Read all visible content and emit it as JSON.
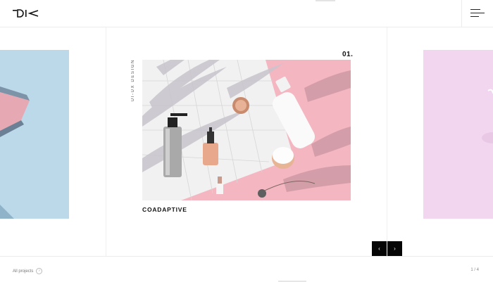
{
  "header": {
    "logo_alt": "logo",
    "menu_icon": "hamburger-icon"
  },
  "slide": {
    "number": "01.",
    "category": "UI-UX DESIGN",
    "title": "COADAPTIVE",
    "prev_label": "‹",
    "next_label": "›"
  },
  "footer": {
    "all_projects": "All projects",
    "all_projects_icon": "›",
    "counter": "1 / 4"
  },
  "colors": {
    "left_slide": "#bcd9ea",
    "right_slide": "#f2d6f0",
    "accent_pink": "#f3b8c3"
  }
}
